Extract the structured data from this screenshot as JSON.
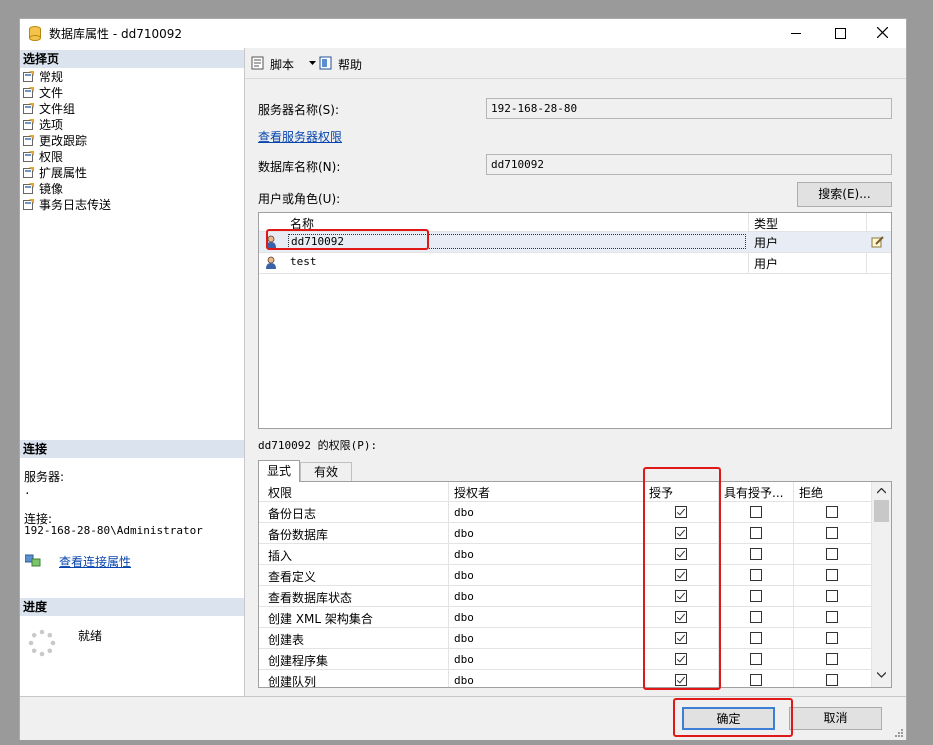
{
  "window": {
    "title": "数据库属性 - dd710092"
  },
  "sidebar": {
    "select_page_header": "选择页",
    "pages": [
      {
        "label": "常规"
      },
      {
        "label": "文件"
      },
      {
        "label": "文件组"
      },
      {
        "label": "选项"
      },
      {
        "label": "更改跟踪"
      },
      {
        "label": "权限"
      },
      {
        "label": "扩展属性"
      },
      {
        "label": "镜像"
      },
      {
        "label": "事务日志传送"
      }
    ],
    "connection_header": "连接",
    "server_label": "服务器:",
    "server_value": ".",
    "connection_label": "连接:",
    "connection_value": "192-168-28-80\\Administrator",
    "view_connection_link": "查看连接属性",
    "progress_header": "进度",
    "progress_status": "就绪"
  },
  "toolbar": {
    "script_label": "脚本",
    "help_label": "帮助"
  },
  "main": {
    "server_name_label": "服务器名称(S):",
    "server_name_value": "192-168-28-80",
    "view_server_permissions_link": "查看服务器权限",
    "db_name_label": "数据库名称(N):",
    "db_name_value": "dd710092",
    "users_roles_label": "用户或角色(U):",
    "search_button": "搜索(E)...",
    "users_table": {
      "columns": [
        "名称",
        "类型"
      ],
      "rows": [
        {
          "name": "dd710092",
          "type": "用户"
        },
        {
          "name": "test",
          "type": "用户"
        }
      ]
    },
    "permissions_label": "dd710092 的权限(P):",
    "tabs": [
      "显式",
      "有效"
    ],
    "permissions_table": {
      "columns": [
        "权限",
        "授权者",
        "授予",
        "具有授予...",
        "拒绝"
      ],
      "rows": [
        {
          "permission": "备份日志",
          "grantor": "dbo",
          "grant": true,
          "with_grant": false,
          "deny": false
        },
        {
          "permission": "备份数据库",
          "grantor": "dbo",
          "grant": true,
          "with_grant": false,
          "deny": false
        },
        {
          "permission": "插入",
          "grantor": "dbo",
          "grant": true,
          "with_grant": false,
          "deny": false
        },
        {
          "permission": "查看定义",
          "grantor": "dbo",
          "grant": true,
          "with_grant": false,
          "deny": false
        },
        {
          "permission": "查看数据库状态",
          "grantor": "dbo",
          "grant": true,
          "with_grant": false,
          "deny": false
        },
        {
          "permission": "创建 XML 架构集合",
          "grantor": "dbo",
          "grant": true,
          "with_grant": false,
          "deny": false
        },
        {
          "permission": "创建表",
          "grantor": "dbo",
          "grant": true,
          "with_grant": false,
          "deny": false
        },
        {
          "permission": "创建程序集",
          "grantor": "dbo",
          "grant": true,
          "with_grant": false,
          "deny": false
        },
        {
          "permission": "创建队列",
          "grantor": "dbo",
          "grant": true,
          "with_grant": false,
          "deny": false
        }
      ]
    }
  },
  "footer": {
    "ok_button": "确定",
    "cancel_button": "取消"
  }
}
